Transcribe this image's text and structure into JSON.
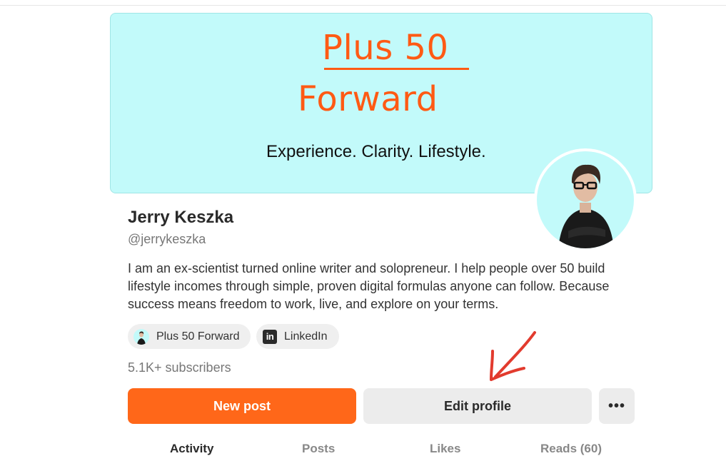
{
  "banner": {
    "title_line1": "Plus 50 ",
    "title_line2": "Forward",
    "tagline": "Experience. Clarity. Lifestyle.",
    "background_color": "#c2fafa",
    "title_color": "#ff5a14"
  },
  "profile": {
    "name": "Jerry Keszka",
    "handle": "@jerrykeszka",
    "bio": "I am an ex-scientist turned online writer and solopreneur. I help people over 50 build lifestyle incomes through simple, proven digital formulas anyone can follow. Because success means freedom to work, live, and explore on your terms.",
    "avatar_icon": "person-photo",
    "subscribers": "5.1K+ subscribers"
  },
  "links": [
    {
      "label": "Plus 50 Forward",
      "icon": "publication-avatar"
    },
    {
      "label": "LinkedIn",
      "icon": "linkedin-icon",
      "icon_text": "in"
    }
  ],
  "actions": {
    "new_post": "New post",
    "edit_profile": "Edit profile",
    "more": "•••",
    "accent_color": "#ff6719"
  },
  "tabs": [
    {
      "label": "Activity",
      "active": true
    },
    {
      "label": "Posts",
      "active": false
    },
    {
      "label": "Likes",
      "active": false
    },
    {
      "label": "Reads (60)",
      "active": false
    }
  ],
  "annotation": {
    "arrow_color": "#e23b2e"
  }
}
